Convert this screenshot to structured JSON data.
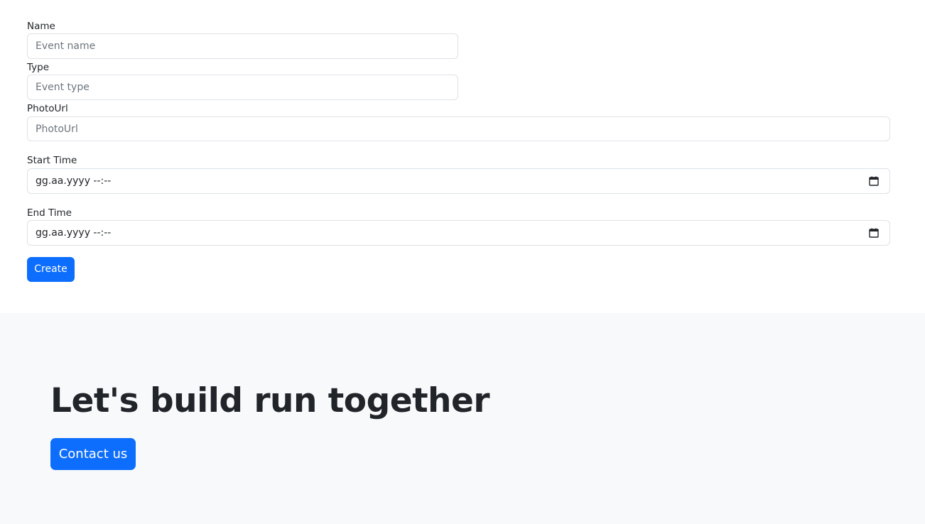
{
  "form": {
    "name": {
      "label": "Name",
      "placeholder": "Event name",
      "value": ""
    },
    "type": {
      "label": "Type",
      "placeholder": "Event type",
      "value": ""
    },
    "photo_url": {
      "label": "PhotoUrl",
      "placeholder": "PhotoUrl",
      "value": ""
    },
    "start_time": {
      "label": "Start Time",
      "value": "gg.aa.yyyy --:--",
      "icon": "calendar-icon"
    },
    "end_time": {
      "label": "End Time",
      "value": "gg.aa.yyyy --:--",
      "icon": "calendar-icon"
    },
    "create_label": "Create"
  },
  "hero": {
    "title": "Let's build run together",
    "contact_label": "Contact us"
  },
  "colors": {
    "primary": "#0d6efd",
    "hero_bg": "#f8f9fa",
    "text": "#212529",
    "border": "#dee2e6"
  }
}
